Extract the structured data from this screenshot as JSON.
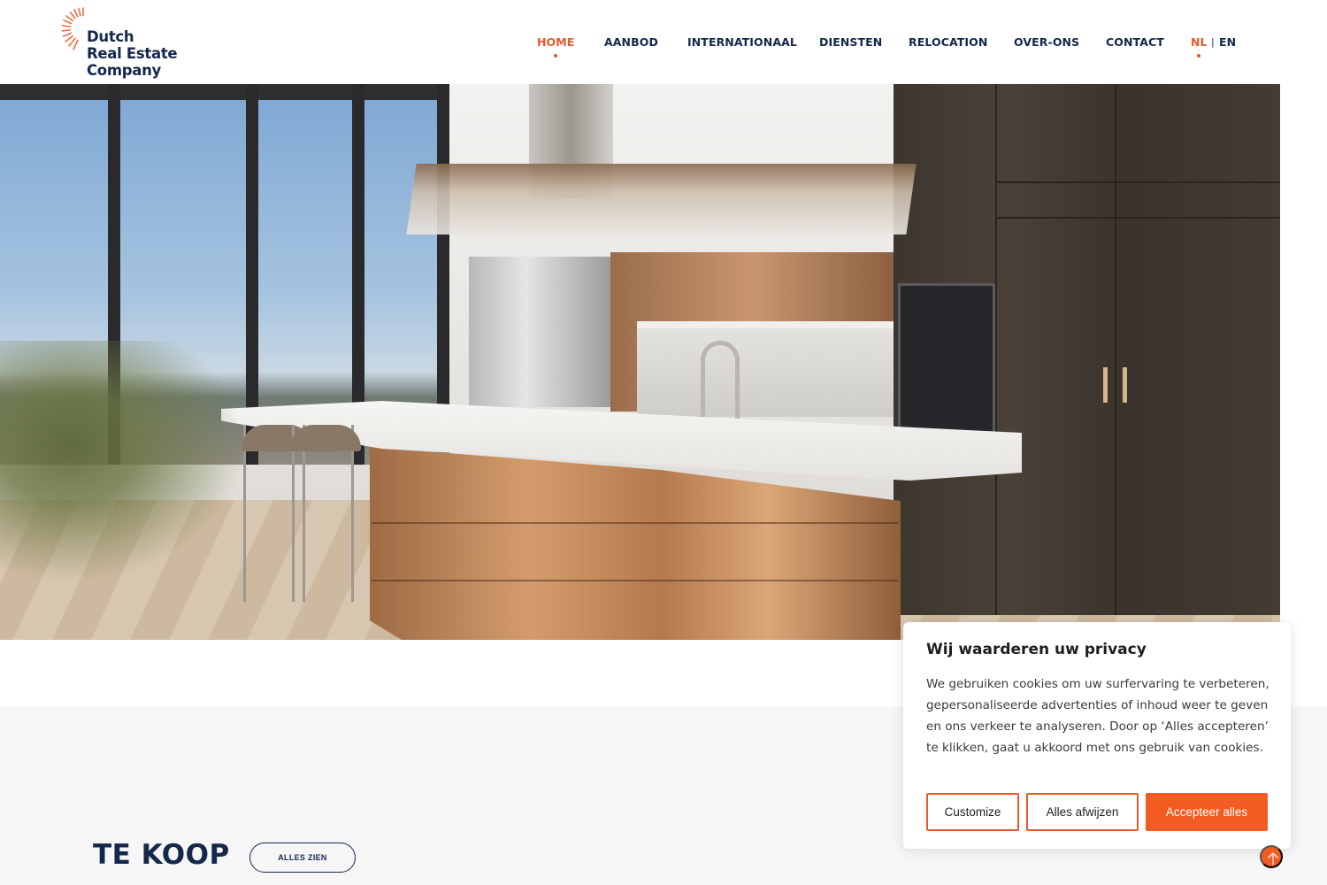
{
  "brand": {
    "name_lines": [
      "Dutch",
      "Real Estate",
      "Company"
    ],
    "accent_color": "#e8582b",
    "navy_color": "#14284b"
  },
  "nav": {
    "items": [
      {
        "label": "HOME",
        "active": true
      },
      {
        "label": "AANBOD",
        "active": false
      },
      {
        "label": "INTERNATIONAAL",
        "active": false
      },
      {
        "label": "DIENSTEN",
        "active": false
      },
      {
        "label": "RELOCATION",
        "active": false
      },
      {
        "label": "OVER-ONS",
        "active": false
      },
      {
        "label": "CONTACT",
        "active": false
      }
    ],
    "languages": [
      {
        "label": "NL",
        "active": true
      },
      {
        "label": "EN",
        "active": false
      }
    ],
    "lang_separator": "|"
  },
  "hero": {
    "image_description": "Modern kitchen with copper island, white marble counter and city view"
  },
  "section": {
    "title": "TE KOOP",
    "all_button": "ALLES ZIEN"
  },
  "cookie_banner": {
    "title": "Wij waarderen uw privacy",
    "text": "We gebruiken cookies om uw surfervaring te verbeteren, gepersonaliseerde advertenties of inhoud weer te geven en ons verkeer te analyseren. Door op ‘Alles accepteren’ te klikken, gaat u akkoord met ons gebruik van cookies.",
    "buttons": {
      "customize": "Customize",
      "reject": "Alles afwijzen",
      "accept": "Accepteer alles"
    }
  },
  "scroll_top": {
    "icon": "arrow-up-icon"
  }
}
